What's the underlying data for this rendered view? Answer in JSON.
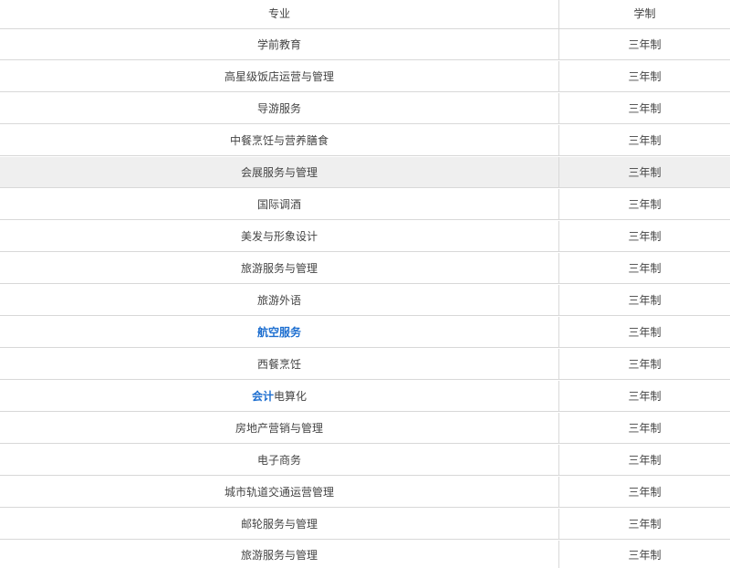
{
  "table": {
    "headers": {
      "major": "专业",
      "years": "学制"
    },
    "rows": [
      {
        "major": "学前教育",
        "years": "三年制"
      },
      {
        "major": "高星级饭店运营与管理",
        "years": "三年制"
      },
      {
        "major": "导游服务",
        "years": "三年制"
      },
      {
        "major": "中餐烹饪与营养膳食",
        "years": "三年制"
      },
      {
        "major": "会展服务与管理",
        "years": "三年制"
      },
      {
        "major": "国际调酒",
        "years": "三年制"
      },
      {
        "major": "美发与形象设计",
        "years": "三年制"
      },
      {
        "major": "旅游服务与管理",
        "years": "三年制"
      },
      {
        "major": "旅游外语",
        "years": "三年制"
      },
      {
        "major": "航空服务",
        "years": "三年制"
      },
      {
        "major": "西餐烹饪",
        "years": "三年制"
      },
      {
        "major_link": "会计",
        "major_rest": "电算化",
        "years": "三年制"
      },
      {
        "major": "房地产营销与管理",
        "years": "三年制"
      },
      {
        "major": "电子商务",
        "years": "三年制"
      },
      {
        "major": "城市轨道交通运营管理",
        "years": "三年制"
      },
      {
        "major": "邮轮服务与管理",
        "years": "三年制"
      },
      {
        "major": "旅游服务与管理",
        "years": "三年制"
      }
    ]
  },
  "colors": {
    "link": "#1e6fd0",
    "hover_row": "#efefef",
    "border": "#d8d8d8",
    "text": "#444444"
  }
}
